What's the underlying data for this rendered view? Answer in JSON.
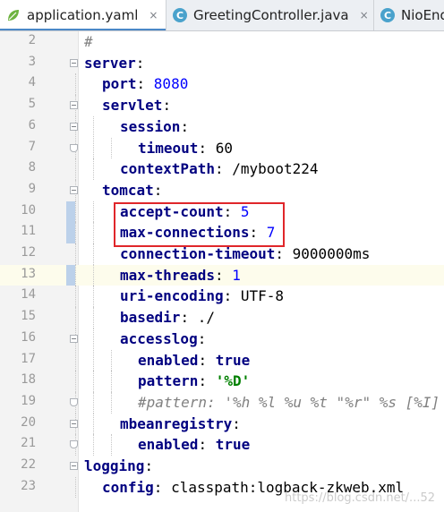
{
  "tabs": [
    {
      "label": "application.yaml",
      "close": "×",
      "icon": "yaml-leaf-icon",
      "active": true
    },
    {
      "label": "GreetingController.java",
      "close": "×",
      "icon": "java-class-icon",
      "glyph": "C",
      "active": false
    },
    {
      "label": "NioEnd",
      "icon": "java-class-icon",
      "glyph": "C",
      "active": false
    }
  ],
  "lines": [
    {
      "num": "2",
      "indent": 0,
      "comment": "#"
    },
    {
      "num": "3",
      "indent": 0,
      "key": "server",
      "sep": ":"
    },
    {
      "num": "4",
      "indent": 1,
      "key": "port",
      "sep": ": ",
      "num_val": "8080"
    },
    {
      "num": "5",
      "indent": 1,
      "key": "servlet",
      "sep": ":"
    },
    {
      "num": "6",
      "indent": 2,
      "key": "session",
      "sep": ":"
    },
    {
      "num": "7",
      "indent": 3,
      "key": "timeout",
      "sep": ": ",
      "plain": "60"
    },
    {
      "num": "8",
      "indent": 2,
      "key": "contextPath",
      "sep": ": ",
      "plain": "/myboot224"
    },
    {
      "num": "9",
      "indent": 1,
      "key": "tomcat",
      "sep": ":"
    },
    {
      "num": "10",
      "indent": 2,
      "key": "accept-count",
      "sep": ": ",
      "num_val": "5"
    },
    {
      "num": "11",
      "indent": 2,
      "key": "max-connections",
      "sep": ": ",
      "num_val": "7"
    },
    {
      "num": "12",
      "indent": 2,
      "key": "connection-timeout",
      "sep": ": ",
      "plain": "9000000ms"
    },
    {
      "num": "13",
      "indent": 2,
      "key": "max-threads",
      "sep": ": ",
      "num_val": "1",
      "current": true
    },
    {
      "num": "14",
      "indent": 2,
      "key": "uri-encoding",
      "sep": ": ",
      "plain": "UTF-8"
    },
    {
      "num": "15",
      "indent": 2,
      "key": "basedir",
      "sep": ": ",
      "plain": "./"
    },
    {
      "num": "16",
      "indent": 2,
      "key": "accesslog",
      "sep": ":"
    },
    {
      "num": "17",
      "indent": 3,
      "key": "enabled",
      "sep": ": ",
      "kw": "true"
    },
    {
      "num": "18",
      "indent": 3,
      "key": "pattern",
      "sep": ": ",
      "str": "'%D'"
    },
    {
      "num": "19",
      "indent": 3,
      "comment": "#pattern: '%h %l %u %t \"%r\" %s [%I]"
    },
    {
      "num": "20",
      "indent": 2,
      "key": "mbeanregistry",
      "sep": ":"
    },
    {
      "num": "21",
      "indent": 3,
      "key": "enabled",
      "sep": ": ",
      "kw": "true"
    },
    {
      "num": "22",
      "indent": 0,
      "key": "logging",
      "sep": ":"
    },
    {
      "num": "23",
      "indent": 1,
      "key": "config",
      "sep": ": ",
      "plain": "classpath:logback-zkweb.xml"
    }
  ],
  "watermark": "https://blog.csdn.net/...52",
  "colors": {
    "highlight_box": "#e0262a",
    "key": "#000080",
    "number": "#0000ff",
    "string": "#008000",
    "comment": "#808080"
  }
}
